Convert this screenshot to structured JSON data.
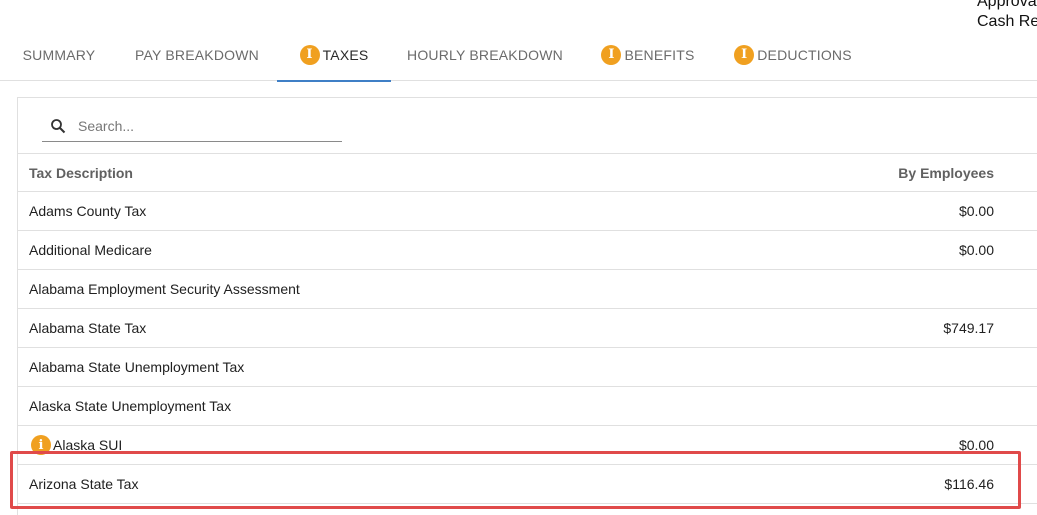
{
  "header": {
    "line1": "Approva",
    "line2": "Cash Re"
  },
  "tabs": [
    {
      "label": "SUMMARY",
      "info": false
    },
    {
      "label": "PAY BREAKDOWN",
      "info": false
    },
    {
      "label": "TAXES",
      "info": true,
      "active": true
    },
    {
      "label": "HOURLY BREAKDOWN",
      "info": false
    },
    {
      "label": "BENEFITS",
      "info": true
    },
    {
      "label": "DEDUCTIONS",
      "info": true
    }
  ],
  "search": {
    "placeholder": "Search..."
  },
  "table": {
    "columns": [
      "Tax Description",
      "By Employees"
    ],
    "rows": [
      {
        "description": "Adams County Tax",
        "amount": "$0.00"
      },
      {
        "description": "Additional Medicare",
        "amount": "$0.00"
      },
      {
        "description": "Alabama Employment Security Assessment",
        "amount": ""
      },
      {
        "description": "Alabama State Tax",
        "amount": "$749.17"
      },
      {
        "description": "Alabama State Unemployment Tax",
        "amount": ""
      },
      {
        "description": "Alaska State Unemployment Tax",
        "amount": ""
      },
      {
        "description": "Alaska SUI",
        "amount": "$0.00",
        "info": true
      },
      {
        "description": "Arizona State Tax",
        "amount": "$116.46"
      }
    ]
  },
  "info_glyph": "i",
  "colors": {
    "accent": "#3f7fc6",
    "info": "#f0a020",
    "highlight": "#e04a4a"
  }
}
